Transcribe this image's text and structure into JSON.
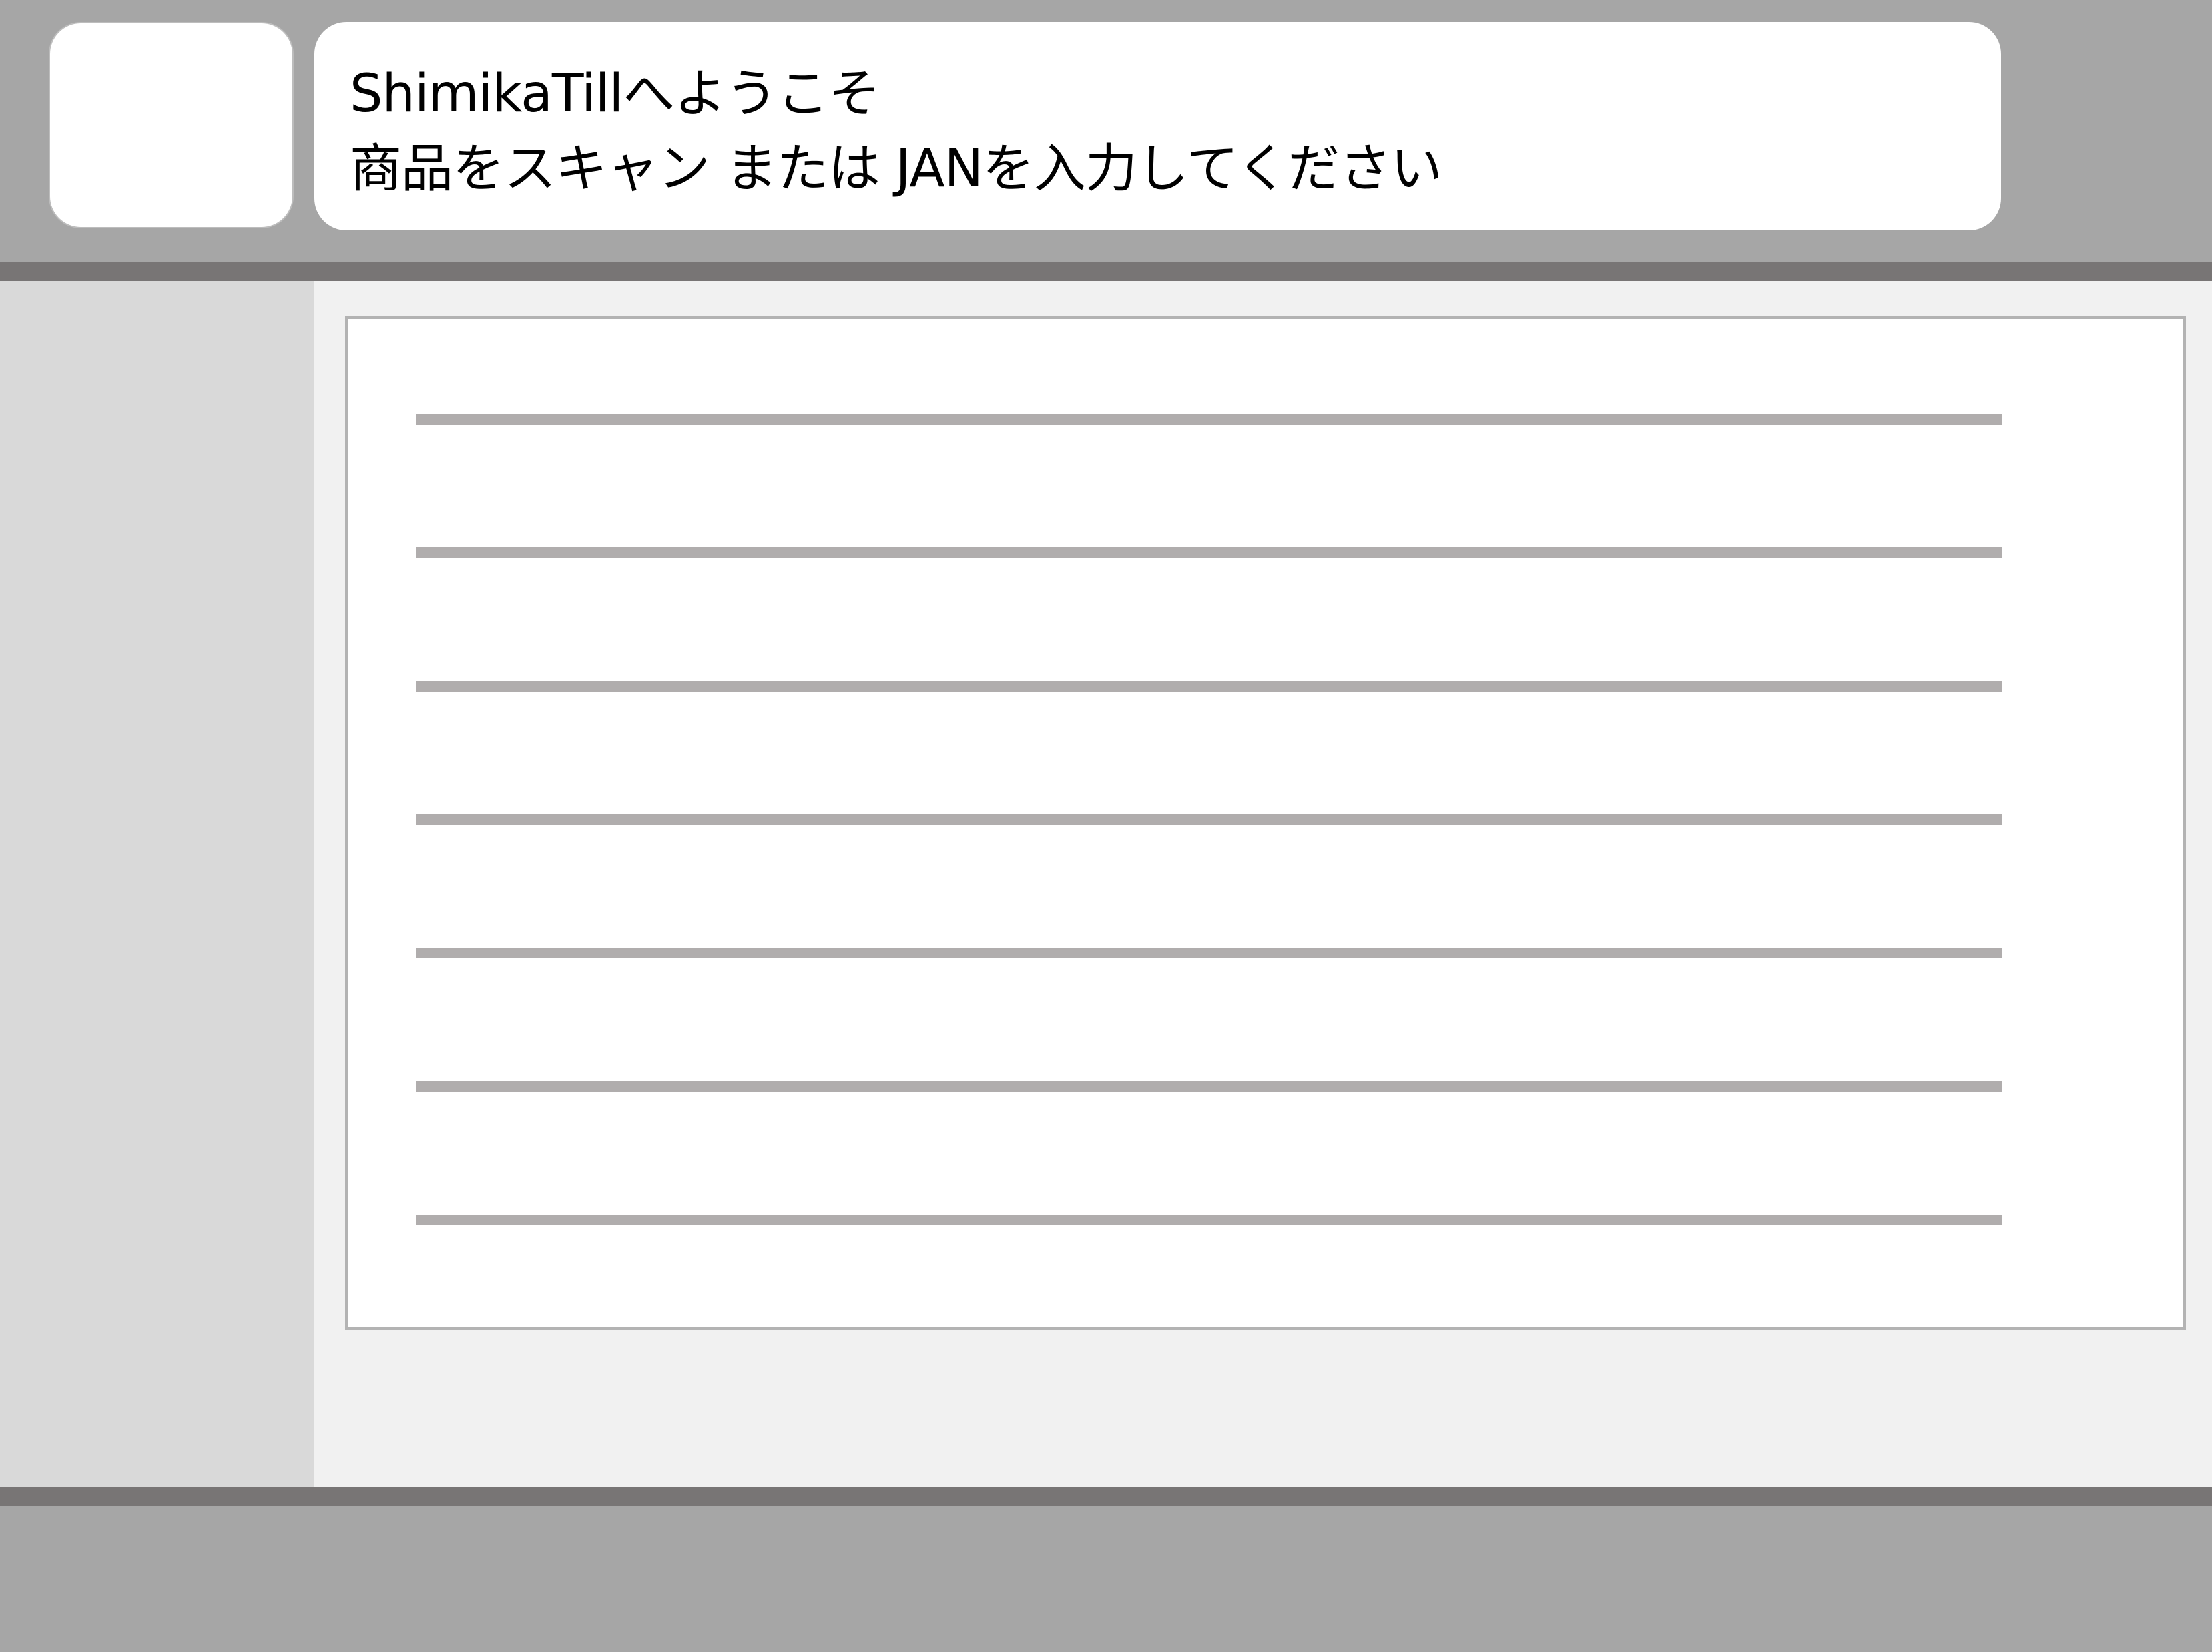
{
  "header": {
    "welcome_text": "ShimikaTillへようこそ",
    "instruction_text": "商品をスキャン または JANを入力してください"
  },
  "item_list": {
    "rows": [
      "",
      "",
      "",
      "",
      "",
      "",
      ""
    ]
  },
  "colors": {
    "header_bg": "#a6a6a6",
    "rule": "#787575",
    "sidebar_bg": "#d9d9d9",
    "main_bg": "#f1f1f1",
    "row_line": "#b0adad"
  }
}
